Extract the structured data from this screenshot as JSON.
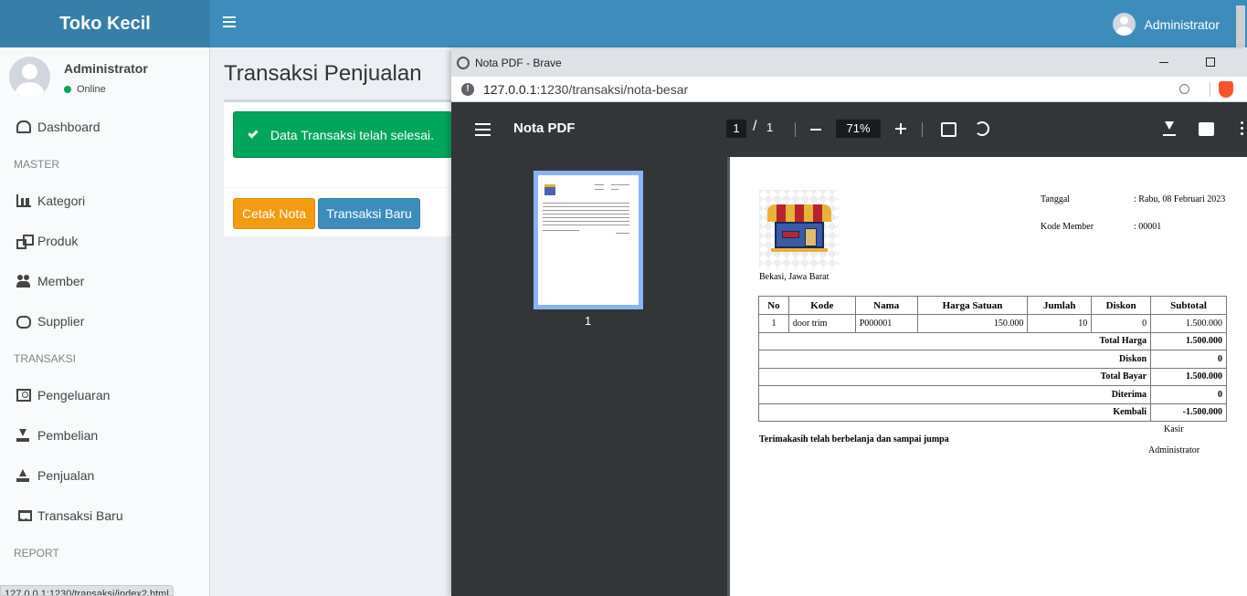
{
  "app": {
    "brand": "Toko Kecil",
    "user_top": "Administrator"
  },
  "sidebar": {
    "user_name": "Administrator",
    "user_status": "Online",
    "headers": {
      "master": "MASTER",
      "transaksi": "TRANSAKSI",
      "report": "REPORT"
    },
    "items": [
      {
        "label": "Dashboard",
        "icon": "dashboard-icon"
      },
      {
        "label": "Kategori",
        "icon": "bar-chart-icon"
      },
      {
        "label": "Produk",
        "icon": "cubes-icon"
      },
      {
        "label": "Member",
        "icon": "users-icon"
      },
      {
        "label": "Supplier",
        "icon": "handshake-icon"
      },
      {
        "label": "Pengeluaran",
        "icon": "money-icon"
      },
      {
        "label": "Pembelian",
        "icon": "download-icon"
      },
      {
        "label": "Penjualan",
        "icon": "upload-icon"
      },
      {
        "label": "Transaksi Baru",
        "icon": "cart-icon"
      }
    ],
    "status_url": "127.0.0.1:1230/transaksi/index2.html"
  },
  "main": {
    "title": "Transaksi Penjualan",
    "alert": "Data Transaksi telah selesai.",
    "btn_cetak": "Cetak Nota",
    "btn_baru": "Transaksi Baru"
  },
  "popup": {
    "window_title": "Nota PDF - Brave",
    "url_host": "127.0.0.1",
    "url_path": ":1230/transaksi/nota-besar",
    "pdf_title": "Nota PDF",
    "page_current": "1",
    "page_sep": "/",
    "page_total": "1",
    "zoom": "71%",
    "thumb_number": "1"
  },
  "nota": {
    "address": "Bekasi, Jawa Barat",
    "tanggal_label": "Tanggal",
    "tanggal_value": ": Rabu, 08 Februari 2023",
    "member_label": "Kode Member",
    "member_value": ": 00001",
    "columns": [
      "No",
      "Kode",
      "Nama",
      "Harga Satuan",
      "Jumlah",
      "Diskon",
      "Subtotal"
    ],
    "rows": [
      [
        "1",
        "door trim",
        "P000001",
        "150.000",
        "10",
        "0",
        "1.500.000"
      ]
    ],
    "summary": [
      {
        "label": "Total Harga",
        "value": "1.500.000"
      },
      {
        "label": "Diskon",
        "value": "0"
      },
      {
        "label": "Total Bayar",
        "value": "1.500.000"
      },
      {
        "label": "Diterima",
        "value": "0"
      },
      {
        "label": "Kembali",
        "value": "-1.500.000"
      }
    ],
    "thanks": "Terimakasih telah berbelanja dan sampai jumpa",
    "kasir_label": "Kasir",
    "kasir_name": "Administrator"
  }
}
